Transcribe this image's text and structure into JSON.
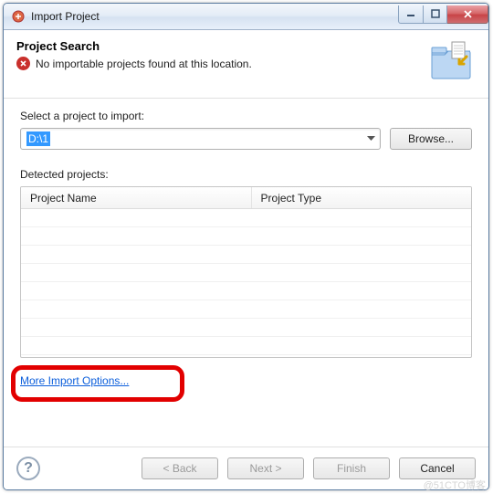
{
  "window": {
    "title": "Import Project"
  },
  "header": {
    "title": "Project Search",
    "message": "No importable projects found at this location."
  },
  "selectLabel": "Select a project to import:",
  "path": {
    "value": "D:\\1"
  },
  "browseLabel": "Browse...",
  "detectedLabel": "Detected projects:",
  "table": {
    "colName": "Project Name",
    "colType": "Project Type"
  },
  "moreOptionsLink": "More Import Options...",
  "buttons": {
    "back": "< Back",
    "next": "Next >",
    "finish": "Finish",
    "cancel": "Cancel"
  },
  "watermark": "@51CTO博客"
}
